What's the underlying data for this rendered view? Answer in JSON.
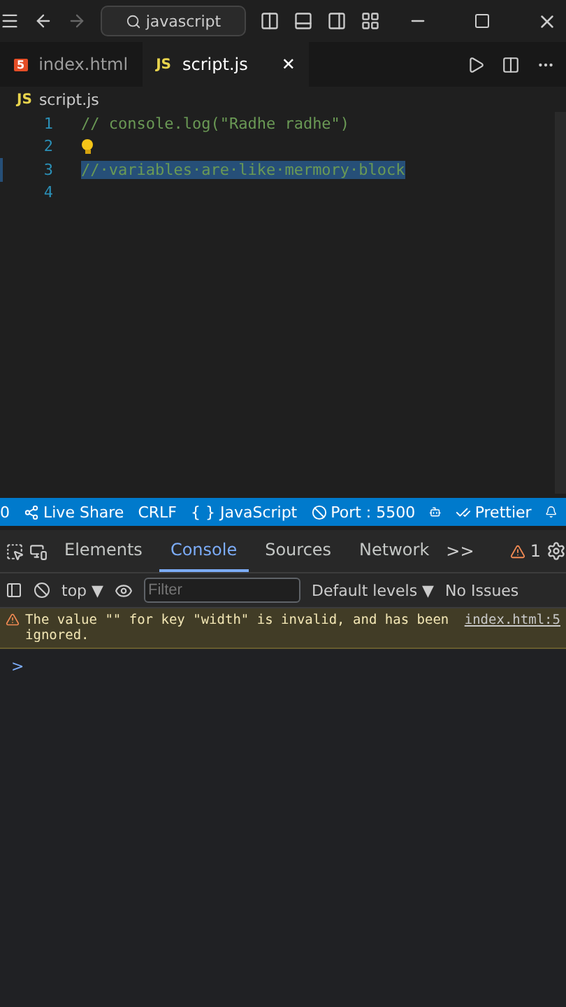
{
  "title_bar": {
    "search": "javascript"
  },
  "tabs": [
    {
      "label": "index.html",
      "icon": "5",
      "selected": false
    },
    {
      "label": "script.js",
      "icon": "JS",
      "selected": true,
      "close": "✕"
    }
  ],
  "breadcrumb": {
    "icon": "JS",
    "label": "script.js"
  },
  "editor": {
    "lines": [
      {
        "number": "1",
        "text": "// console.log(\"Radhe radhe\")",
        "selected": false,
        "bulb": false
      },
      {
        "number": "2",
        "selected": false,
        "bulb": true
      },
      {
        "number": "3",
        "text": "//·variables·are·like·mermory·block",
        "selected": true,
        "bulb": false
      },
      {
        "number": "4",
        "selected": false,
        "bulb": false
      }
    ]
  },
  "status_bar": [
    {
      "kind": "plain",
      "label": "0"
    },
    {
      "kind": "live",
      "label": "Live Share"
    },
    {
      "kind": "plain",
      "label": "CRLF"
    },
    {
      "kind": "plain",
      "label": "{ } JavaScript"
    },
    {
      "kind": "port",
      "label": "Port : 5500"
    },
    {
      "kind": "copilot"
    },
    {
      "kind": "prettier",
      "label": "Prettier"
    },
    {
      "kind": "bell"
    }
  ],
  "devtools": {
    "tabs": [
      {
        "label": "Elements",
        "selected": false
      },
      {
        "label": "Console",
        "selected": true
      },
      {
        "label": "Sources",
        "selected": false
      },
      {
        "label": "Network",
        "selected": false
      }
    ],
    "more": ">>",
    "warning_count": "1",
    "context": "top ▼",
    "filter_placeholder": "Filter",
    "levels": "Default levels ▼",
    "issues": "No Issues",
    "messages": [
      {
        "text": "The value \"\" for key \"width\" is invalid, and has been ignored.",
        "source": "index.html:5"
      }
    ],
    "prompt": ">"
  }
}
